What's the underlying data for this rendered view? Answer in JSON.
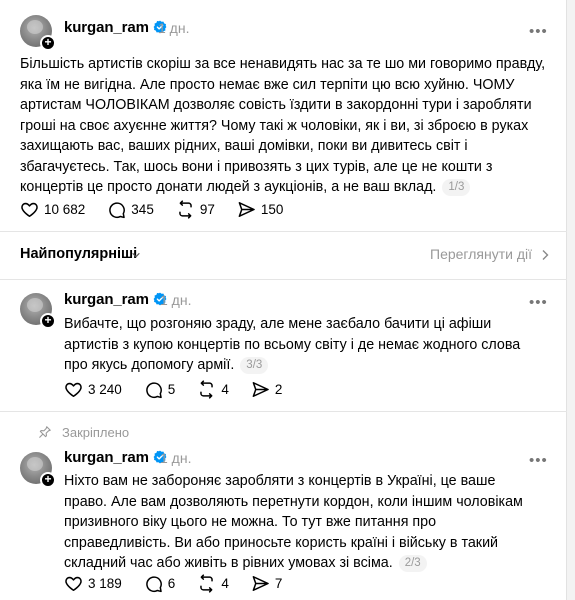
{
  "colors": {
    "verified": "#0095f6",
    "muted": "#999999",
    "divider": "#e5e5e5"
  },
  "main_post": {
    "username": "kurgan_ram",
    "time": "1 дн.",
    "text": "Більшість артистів скоріш за все ненавидять нас за те шо ми говоримо правду, яка їм не вигідна. Але просто немає вже сил терпіти цю всю хуйню. ЧОМУ артистам ЧОЛОВІКАМ дозволяє совість їздити в закордонні тури і заробляти гроші на своє ахуєнне життя? Чому такі ж чоловіки, як і ви, зі зброєю в руках захищають вас, ваших рідних, ваші домівки, поки ви дивитесь світ і збагачуєтесь. Так, шось вони і привозять з цих турів, але це не кошти з концертів це просто донати людей з аукціонів, а не ваш вклад.",
    "pager": "1/3",
    "likes": "10 682",
    "comments": "345",
    "reposts": "97",
    "shares": "150"
  },
  "sort": {
    "label": "Найпопулярніші",
    "view_activity": "Переглянути дії"
  },
  "reply1": {
    "username": "kurgan_ram",
    "time": "1 дн.",
    "text": "Вибачте, що розгоняю зраду, але мене заєбало бачити ці афіши артистів з купою концертів по всьому світу і де немає жодного слова про якусь допомогу армії.",
    "pager": "3/3",
    "likes": "3 240",
    "comments": "5",
    "reposts": "4",
    "shares": "2"
  },
  "pinned_label": "Закріплено",
  "reply2": {
    "username": "kurgan_ram",
    "time": "1 дн.",
    "text": "Ніхто вам не забороняє заробляти з концертів в Україні, це ваше право. Але вам дозволяють перетнути кордон, коли іншим чоловікам призивного віку цього не можна. То тут вже питання про справедливість. Ви або приносьте користь країні і війську в такий складний час або живіть в рівних умовах зі всіма.",
    "pager": "2/3",
    "likes": "3 189",
    "comments": "6",
    "reposts": "4",
    "shares": "7"
  }
}
